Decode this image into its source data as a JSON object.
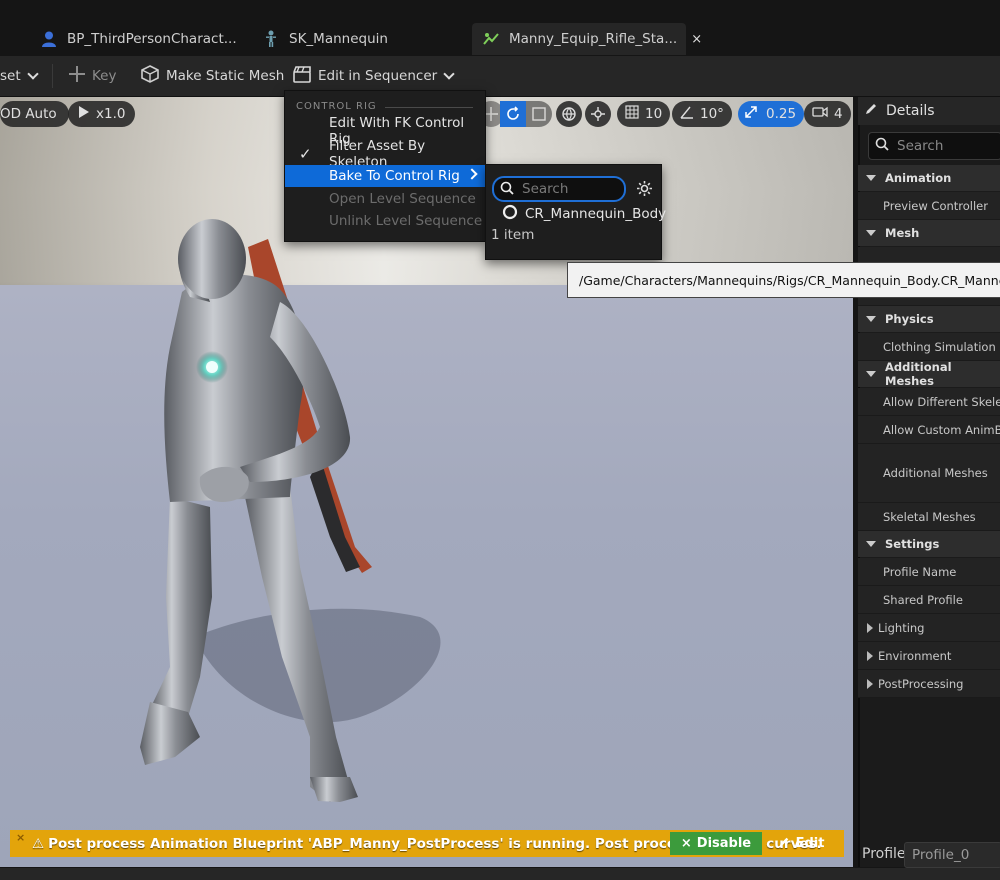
{
  "tabs": [
    {
      "label": "BP_ThirdPersonCharact...",
      "icon": "person-icon"
    },
    {
      "label": "SK_Mannequin",
      "icon": "skeleton-icon"
    },
    {
      "label": "Manny_Equip_Rifle_Sta...",
      "icon": "animation-icon",
      "active": true,
      "close": "×"
    }
  ],
  "toolbar": {
    "asset_label": "set",
    "key_label": "Key",
    "make_static_mesh_label": "Make Static Mesh",
    "edit_in_sequencer_label": "Edit in Sequencer"
  },
  "viewport": {
    "lod_label": "OD Auto",
    "play_speed": "x1.0",
    "grid_snap": "10",
    "rotation_snap": "10°",
    "scale_snap": "0.25",
    "camera_speed": "4"
  },
  "menu": {
    "section_header": "CONTROL RIG",
    "items": [
      {
        "label": "Edit With FK Control Rig",
        "state": "normal"
      },
      {
        "label": "Filter Asset By Skeleton",
        "state": "checked",
        "check": "✓"
      },
      {
        "label": "Bake To Control Rig",
        "state": "selected"
      },
      {
        "label": "Open Level Sequence",
        "state": "disabled"
      },
      {
        "label": "Unlink Level Sequence",
        "state": "disabled"
      }
    ]
  },
  "submenu": {
    "search_placeholder": "Search",
    "result_label": "CR_Mannequin_Body",
    "count_label": "1 item"
  },
  "tooltip": {
    "text": "/Game/Characters/Mannequins/Rigs/CR_Mannequin_Body.CR_Mannequin_Bo"
  },
  "details": {
    "title": "Details",
    "search_placeholder": "Search",
    "categories": {
      "animation": "Animation",
      "mesh": "Mesh",
      "physics": "Physics",
      "additional_meshes": "Additional Meshes",
      "settings": "Settings"
    },
    "props": {
      "preview_controller": "Preview Controller",
      "clothing_sim": "Clothing Simulation Fact",
      "allow_diff_skel": "Allow Different Skeletons",
      "allow_custom_animbp": "Allow Custom AnimBP O",
      "additional_meshes": "Additional Meshes",
      "skeletal_meshes": "Skeletal Meshes",
      "profile_name": "Profile Name",
      "shared_profile": "Shared Profile",
      "lighting": "Lighting",
      "environment": "Environment",
      "post_processing": "PostProcessing"
    },
    "profile_label": "Profile",
    "profile_value": "Profile_0"
  },
  "warning": {
    "icon": "⚠",
    "close": "×",
    "text": "Post process Animation Blueprint 'ABP_Manny_PostProcess' is running. Post process modifies curves.",
    "disable_label": "Disable",
    "disable_icon": "×",
    "edit_label": "Edit"
  },
  "colors": {
    "accent": "#0e6ad8",
    "warning": "#e3a40b",
    "disable_green": "#3c9b3c"
  }
}
